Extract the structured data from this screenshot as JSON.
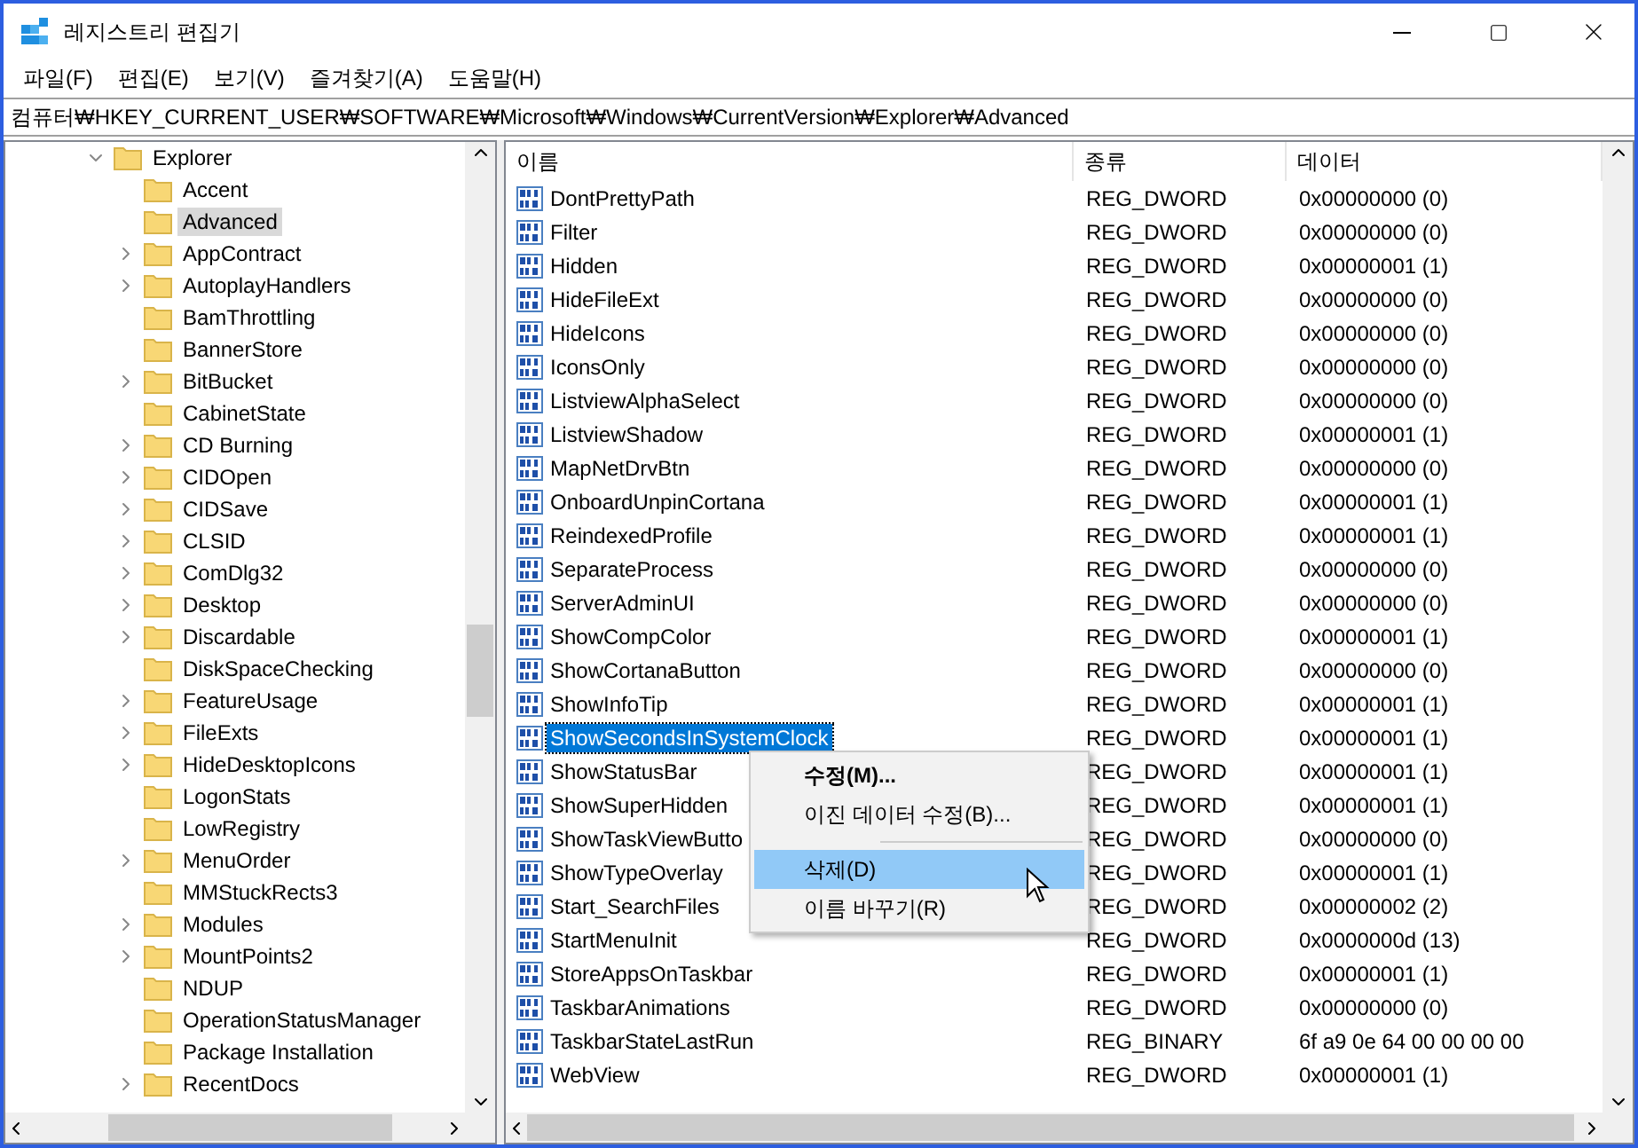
{
  "window": {
    "title": "레지스트리 편집기"
  },
  "menu": [
    "파일(F)",
    "편집(E)",
    "보기(V)",
    "즐겨찾기(A)",
    "도움말(H)"
  ],
  "address": "컴퓨터₩HKEY_CURRENT_USER₩SOFTWARE₩Microsoft₩Windows₩CurrentVersion₩Explorer₩Advanced",
  "tree": {
    "label": "Explorer",
    "expanded": true,
    "children": [
      {
        "label": "Accent",
        "has_children": false,
        "selected": false
      },
      {
        "label": "Advanced",
        "has_children": false,
        "selected": true
      },
      {
        "label": "AppContract",
        "has_children": true,
        "selected": false
      },
      {
        "label": "AutoplayHandlers",
        "has_children": true,
        "selected": false
      },
      {
        "label": "BamThrottling",
        "has_children": false,
        "selected": false
      },
      {
        "label": "BannerStore",
        "has_children": false,
        "selected": false
      },
      {
        "label": "BitBucket",
        "has_children": true,
        "selected": false
      },
      {
        "label": "CabinetState",
        "has_children": false,
        "selected": false
      },
      {
        "label": "CD Burning",
        "has_children": true,
        "selected": false
      },
      {
        "label": "CIDOpen",
        "has_children": true,
        "selected": false
      },
      {
        "label": "CIDSave",
        "has_children": true,
        "selected": false
      },
      {
        "label": "CLSID",
        "has_children": true,
        "selected": false
      },
      {
        "label": "ComDlg32",
        "has_children": true,
        "selected": false
      },
      {
        "label": "Desktop",
        "has_children": true,
        "selected": false
      },
      {
        "label": "Discardable",
        "has_children": true,
        "selected": false
      },
      {
        "label": "DiskSpaceChecking",
        "has_children": false,
        "selected": false
      },
      {
        "label": "FeatureUsage",
        "has_children": true,
        "selected": false
      },
      {
        "label": "FileExts",
        "has_children": true,
        "selected": false
      },
      {
        "label": "HideDesktopIcons",
        "has_children": true,
        "selected": false
      },
      {
        "label": "LogonStats",
        "has_children": false,
        "selected": false
      },
      {
        "label": "LowRegistry",
        "has_children": false,
        "selected": false
      },
      {
        "label": "MenuOrder",
        "has_children": true,
        "selected": false
      },
      {
        "label": "MMStuckRects3",
        "has_children": false,
        "selected": false
      },
      {
        "label": "Modules",
        "has_children": true,
        "selected": false
      },
      {
        "label": "MountPoints2",
        "has_children": true,
        "selected": false
      },
      {
        "label": "NDUP",
        "has_children": false,
        "selected": false
      },
      {
        "label": "OperationStatusManager",
        "has_children": false,
        "selected": false
      },
      {
        "label": "Package Installation",
        "has_children": false,
        "selected": false
      },
      {
        "label": "RecentDocs",
        "has_children": true,
        "selected": false
      }
    ]
  },
  "table": {
    "columns": [
      "이름",
      "종류",
      "데이터"
    ],
    "rows": [
      {
        "name": "DontPrettyPath",
        "type": "REG_DWORD",
        "data": "0x00000000 (0)",
        "selected": false
      },
      {
        "name": "Filter",
        "type": "REG_DWORD",
        "data": "0x00000000 (0)",
        "selected": false
      },
      {
        "name": "Hidden",
        "type": "REG_DWORD",
        "data": "0x00000001 (1)",
        "selected": false
      },
      {
        "name": "HideFileExt",
        "type": "REG_DWORD",
        "data": "0x00000000 (0)",
        "selected": false
      },
      {
        "name": "HideIcons",
        "type": "REG_DWORD",
        "data": "0x00000000 (0)",
        "selected": false
      },
      {
        "name": "IconsOnly",
        "type": "REG_DWORD",
        "data": "0x00000000 (0)",
        "selected": false
      },
      {
        "name": "ListviewAlphaSelect",
        "type": "REG_DWORD",
        "data": "0x00000000 (0)",
        "selected": false
      },
      {
        "name": "ListviewShadow",
        "type": "REG_DWORD",
        "data": "0x00000001 (1)",
        "selected": false
      },
      {
        "name": "MapNetDrvBtn",
        "type": "REG_DWORD",
        "data": "0x00000000 (0)",
        "selected": false
      },
      {
        "name": "OnboardUnpinCortana",
        "type": "REG_DWORD",
        "data": "0x00000001 (1)",
        "selected": false
      },
      {
        "name": "ReindexedProfile",
        "type": "REG_DWORD",
        "data": "0x00000001 (1)",
        "selected": false
      },
      {
        "name": "SeparateProcess",
        "type": "REG_DWORD",
        "data": "0x00000000 (0)",
        "selected": false
      },
      {
        "name": "ServerAdminUI",
        "type": "REG_DWORD",
        "data": "0x00000000 (0)",
        "selected": false
      },
      {
        "name": "ShowCompColor",
        "type": "REG_DWORD",
        "data": "0x00000001 (1)",
        "selected": false
      },
      {
        "name": "ShowCortanaButton",
        "type": "REG_DWORD",
        "data": "0x00000000 (0)",
        "selected": false
      },
      {
        "name": "ShowInfoTip",
        "type": "REG_DWORD",
        "data": "0x00000001 (1)",
        "selected": false
      },
      {
        "name": "ShowSecondsInSystemClock",
        "type": "REG_DWORD",
        "data": "0x00000001 (1)",
        "selected": true
      },
      {
        "name": "ShowStatusBar",
        "type": "REG_DWORD",
        "data": "0x00000001 (1)",
        "selected": false
      },
      {
        "name": "ShowSuperHidden",
        "type": "REG_DWORD",
        "data": "0x00000001 (1)",
        "selected": false
      },
      {
        "name": "ShowTaskViewButto",
        "type": "REG_DWORD",
        "data": "0x00000000 (0)",
        "selected": false
      },
      {
        "name": "ShowTypeOverlay",
        "type": "REG_DWORD",
        "data": "0x00000001 (1)",
        "selected": false
      },
      {
        "name": "Start_SearchFiles",
        "type": "REG_DWORD",
        "data": "0x00000002 (2)",
        "selected": false
      },
      {
        "name": "StartMenuInit",
        "type": "REG_DWORD",
        "data": "0x0000000d (13)",
        "selected": false
      },
      {
        "name": "StoreAppsOnTaskbar",
        "type": "REG_DWORD",
        "data": "0x00000001 (1)",
        "selected": false
      },
      {
        "name": "TaskbarAnimations",
        "type": "REG_DWORD",
        "data": "0x00000000 (0)",
        "selected": false
      },
      {
        "name": "TaskbarStateLastRun",
        "type": "REG_BINARY",
        "data": "6f a9 0e 64 00 00 00 00",
        "selected": false
      },
      {
        "name": "WebView",
        "type": "REG_DWORD",
        "data": "0x00000001 (1)",
        "selected": false
      }
    ]
  },
  "context_menu": [
    {
      "kind": "item",
      "label": "수정(M)...",
      "default": true,
      "selected": false
    },
    {
      "kind": "item",
      "label": "이진 데이터 수정(B)...",
      "default": false,
      "selected": false
    },
    {
      "kind": "separator"
    },
    {
      "kind": "item",
      "label": "삭제(D)",
      "default": false,
      "selected": true
    },
    {
      "kind": "item",
      "label": "이름 바꾸기(R)",
      "default": false,
      "selected": false
    }
  ]
}
